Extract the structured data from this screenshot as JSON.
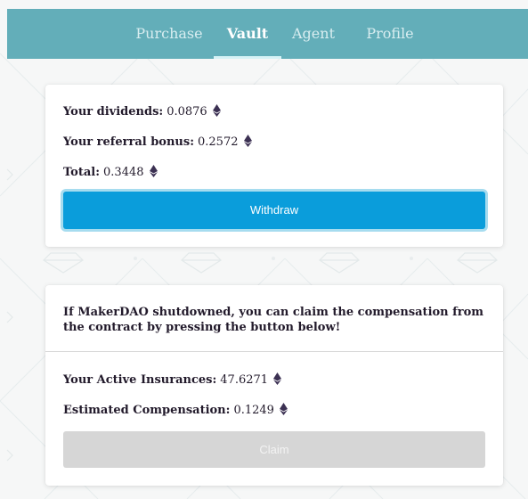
{
  "nav": {
    "tabs": [
      {
        "label": "Purchase",
        "active": false
      },
      {
        "label": "Vault",
        "active": true
      },
      {
        "label": "Agent",
        "active": false
      },
      {
        "label": "Profile",
        "active": false
      }
    ]
  },
  "vault": {
    "dividends_label": "Your dividends:",
    "dividends_value": "0.0876",
    "referral_label": "Your referral bonus:",
    "referral_value": "0.2572",
    "total_label": "Total:",
    "total_value": "0.3448",
    "withdraw_label": "Withdraw"
  },
  "insurance": {
    "notice": "If MakerDAO shutdowned, you can claim the compensation from the contract by pressing the button below!",
    "active_label": "Your Active Insurances:",
    "active_value": "47.6271",
    "compensation_label": "Estimated Compensation:",
    "compensation_value": "0.1249",
    "claim_label": "Claim"
  },
  "colors": {
    "topbar": "#63aeb9",
    "primary_button": "#0a9ddb",
    "disabled_button": "#d6d6d6",
    "currency_icon": "#3c3153"
  },
  "icons": {
    "currency": "ethereum-icon",
    "background": "diamond-pattern"
  }
}
